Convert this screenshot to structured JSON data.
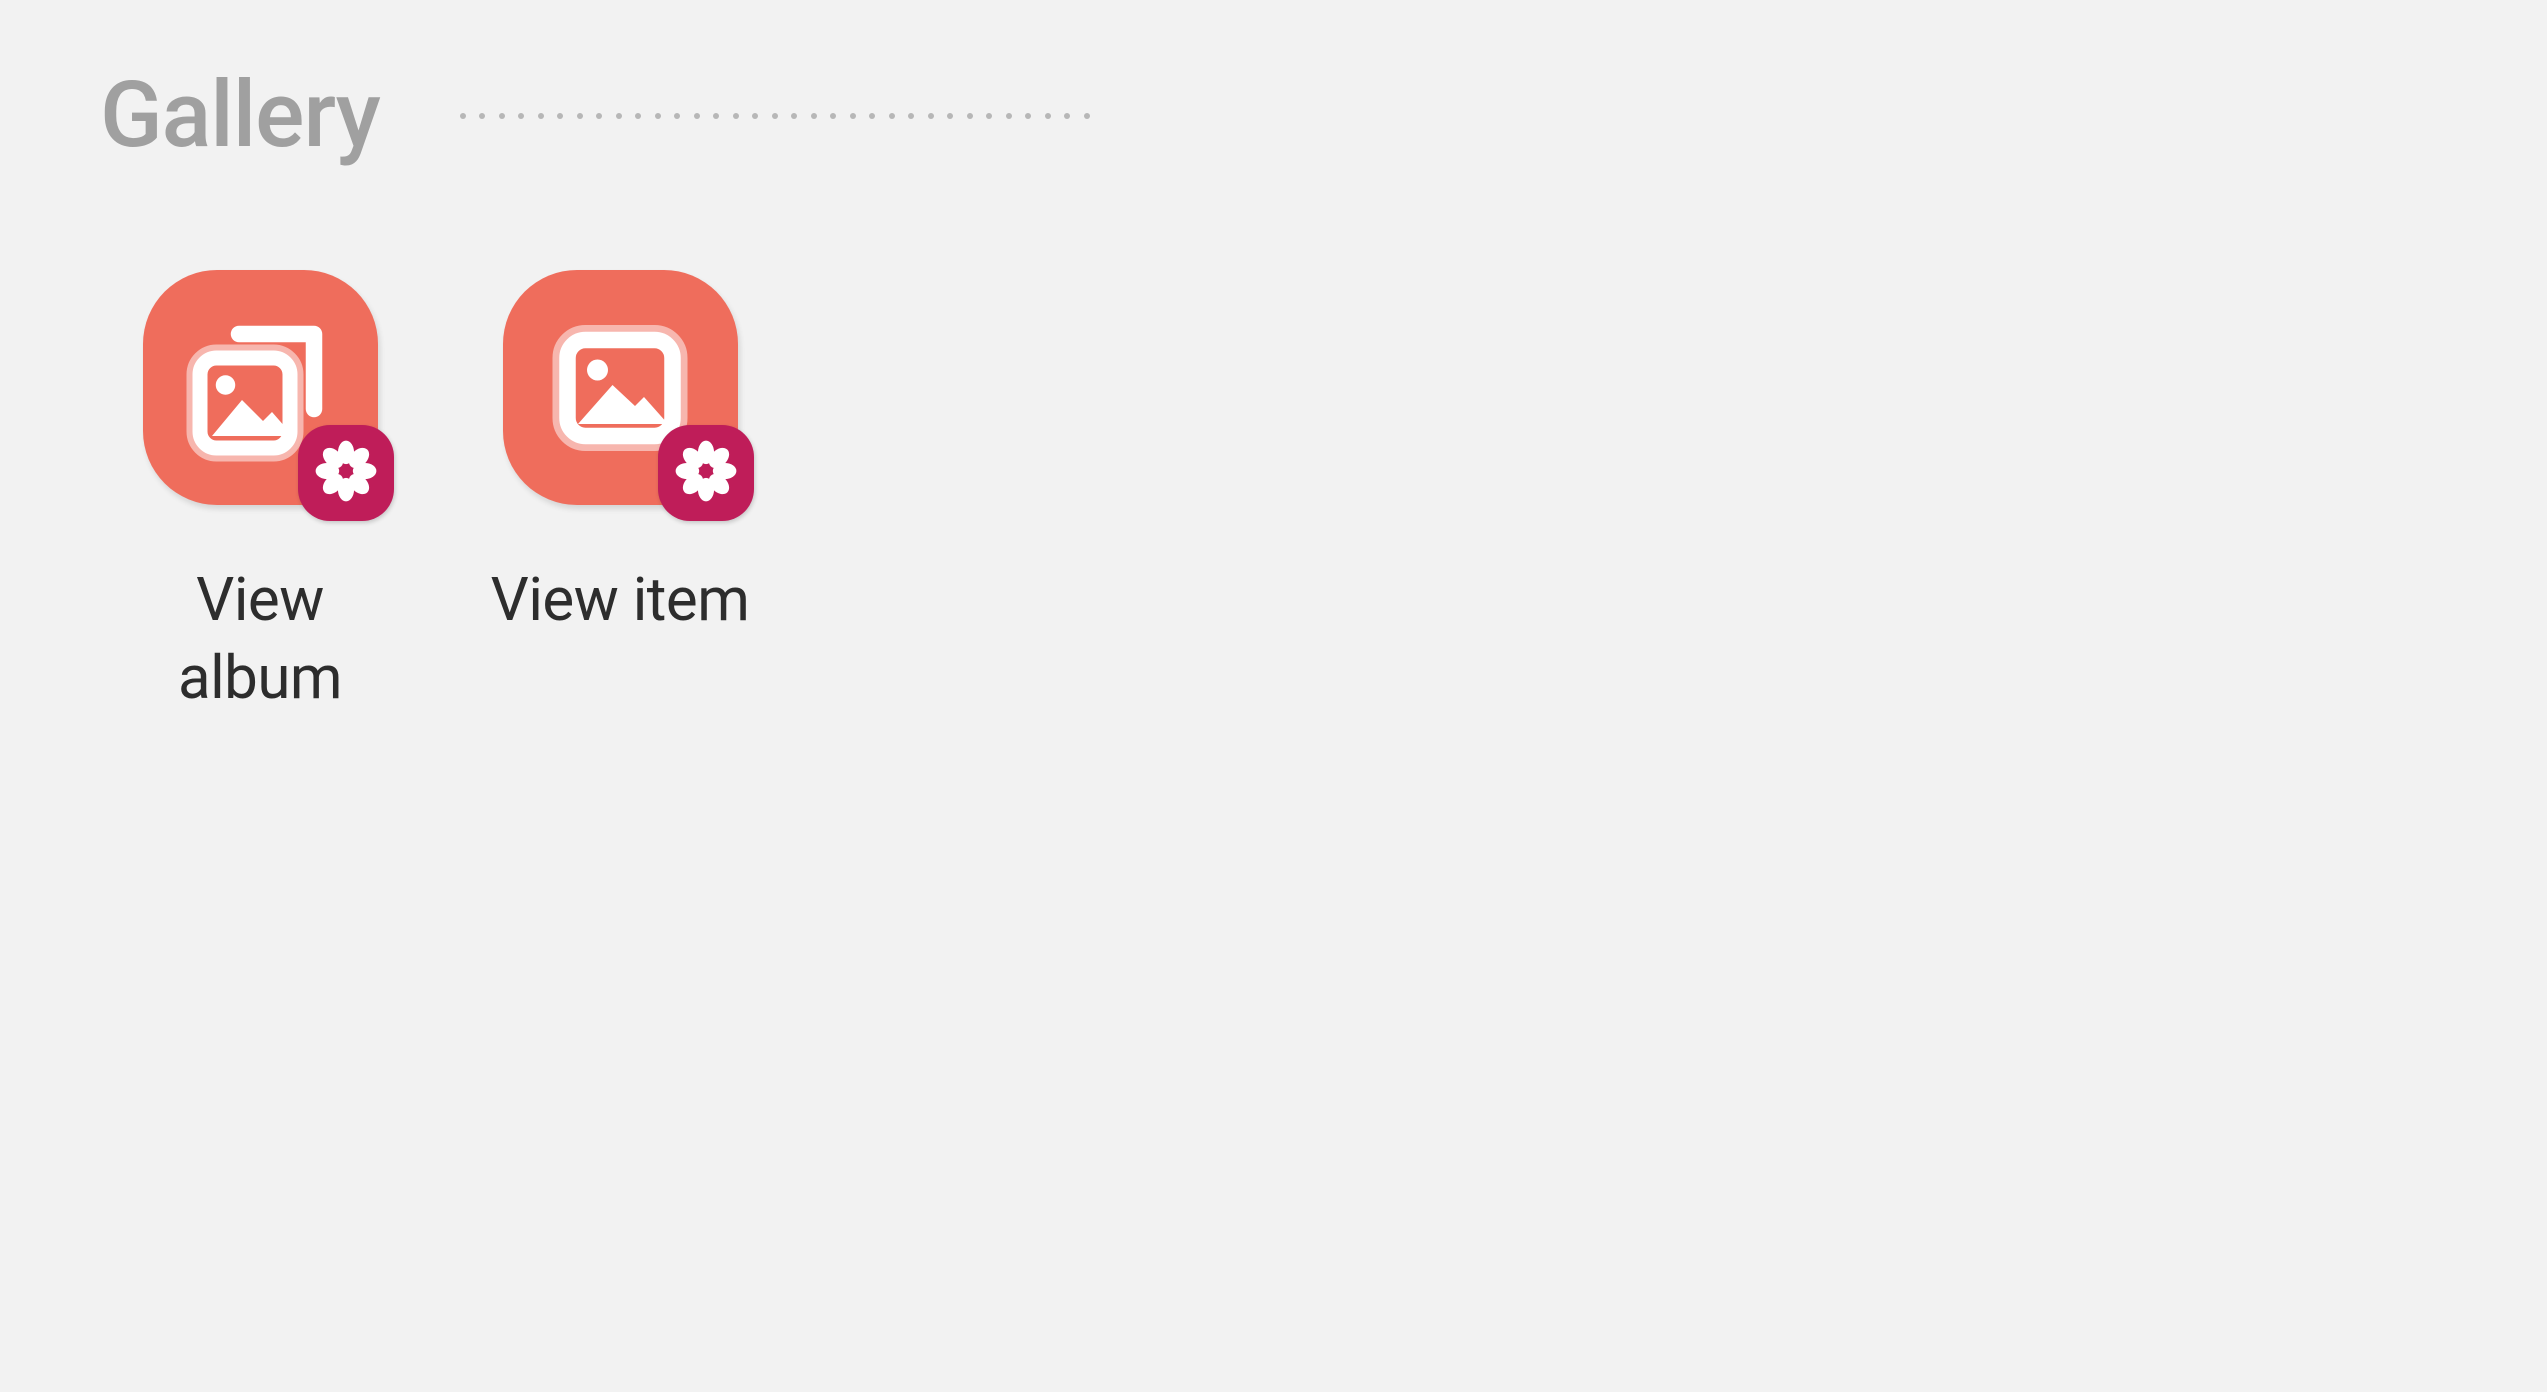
{
  "section_title": "Gallery",
  "shortcuts": [
    {
      "label": "View album",
      "icon": "gallery-album-icon"
    },
    {
      "label": "View item",
      "icon": "gallery-item-icon"
    }
  ],
  "colors": {
    "tile": "#ef6d5c",
    "badge": "#bf1d59",
    "bg": "#f2f2f2",
    "title": "#a0a0a0",
    "text": "#2d2d2d"
  }
}
